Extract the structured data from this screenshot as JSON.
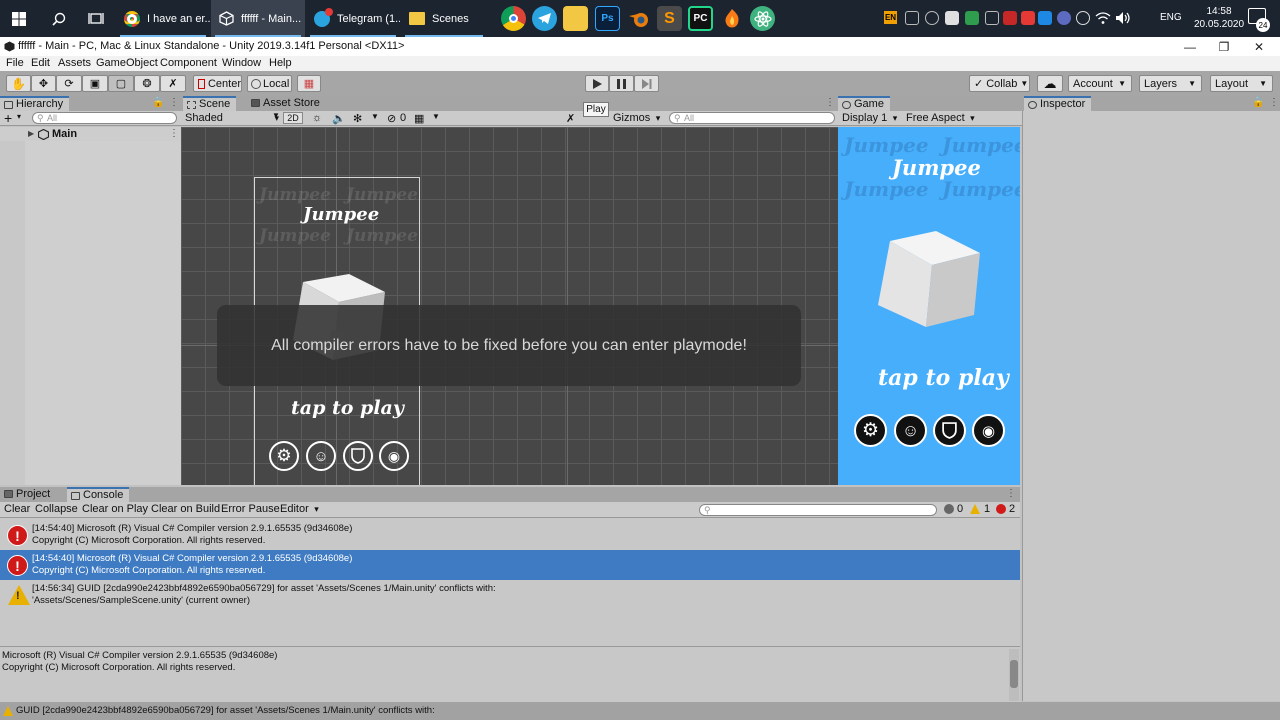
{
  "taskbar": {
    "tasks": [
      {
        "label": "I have an er..."
      },
      {
        "label": "ffffff - Main..."
      },
      {
        "label": "Telegram (1..."
      },
      {
        "label": "Scenes"
      }
    ],
    "pinned": [
      {
        "name": "chrome",
        "color": "#dd4b39"
      },
      {
        "name": "telegram",
        "color": "#2aa3df"
      },
      {
        "name": "explorer",
        "color": "#f2c744"
      },
      {
        "name": "photoshop",
        "color": "#0a1f3a",
        "label": "Ps"
      },
      {
        "name": "blender",
        "color": "#e87d0d"
      },
      {
        "name": "sublime",
        "color": "#ff9800",
        "label": "S"
      },
      {
        "name": "pycharm",
        "color": "#1b1b1b",
        "label": "PC"
      },
      {
        "name": "fl-studio",
        "color": "#f97a16"
      },
      {
        "name": "atom",
        "color": "#3fb37f"
      }
    ],
    "tray": {
      "lang_badge": "EN",
      "lang": "ENG",
      "time": "14:58",
      "date": "20.05.2020",
      "notifications": "24"
    }
  },
  "window": {
    "title": "ffffff - Main - PC, Mac & Linux Standalone - Unity 2019.3.14f1 Personal <DX11>"
  },
  "menu": [
    "File",
    "Edit",
    "Assets",
    "GameObject",
    "Component",
    "Window",
    "Help"
  ],
  "toolbar": {
    "pivot": "Center",
    "space": "Local",
    "collab": "Collab",
    "account": "Account",
    "layers": "Layers",
    "layout": "Layout",
    "tooltip": "Play"
  },
  "hierarchy": {
    "tab": "Hierarchy",
    "search_placeholder": "All",
    "items": [
      {
        "label": "Main"
      }
    ]
  },
  "scene": {
    "tabs": [
      "Scene",
      "Asset Store"
    ],
    "shading": "Shaded",
    "mode_2d": "2D",
    "hidden_count": "0",
    "gizmos": "Gizmos",
    "search_placeholder": "All"
  },
  "game": {
    "tab": "Game",
    "display": "Display 1",
    "aspect": "Free Aspect",
    "logo": "Jumpee",
    "tap_text": "tap to play"
  },
  "inspector": {
    "tab": "Inspector"
  },
  "notice": "All compiler errors have to be fixed before you can enter playmode!",
  "console": {
    "tabs": [
      "Project",
      "Console"
    ],
    "buttons": [
      "Clear",
      "Collapse",
      "Clear on Play",
      "Clear on Build",
      "Error Pause",
      "Editor"
    ],
    "counts": {
      "info": "0",
      "warnings": "1",
      "errors": "2"
    },
    "entries": [
      {
        "type": "error",
        "line1": "[14:54:40] Microsoft (R) Visual C# Compiler version 2.9.1.65535 (9d34608e)",
        "line2": "Copyright (C) Microsoft Corporation. All rights reserved.",
        "selected": false
      },
      {
        "type": "error",
        "line1": "[14:54:40] Microsoft (R) Visual C# Compiler version 2.9.1.65535 (9d34608e)",
        "line2": "Copyright (C) Microsoft Corporation. All rights reserved.",
        "selected": true
      },
      {
        "type": "warning",
        "line1": "[14:56:34] GUID [2cda990e2423bbf4892e6590ba056729] for asset 'Assets/Scenes 1/Main.unity' conflicts with:",
        "line2": "  'Assets/Scenes/SampleScene.unity' (current owner)",
        "selected": false
      }
    ],
    "detail": {
      "line1": "Microsoft (R) Visual C# Compiler version 2.9.1.65535 (9d34608e)",
      "line2": "Copyright (C) Microsoft Corporation. All rights reserved."
    },
    "status": "GUID [2cda990e2423bbf4892e6590ba056729] for asset 'Assets/Scenes 1/Main.unity' conflicts with:"
  }
}
